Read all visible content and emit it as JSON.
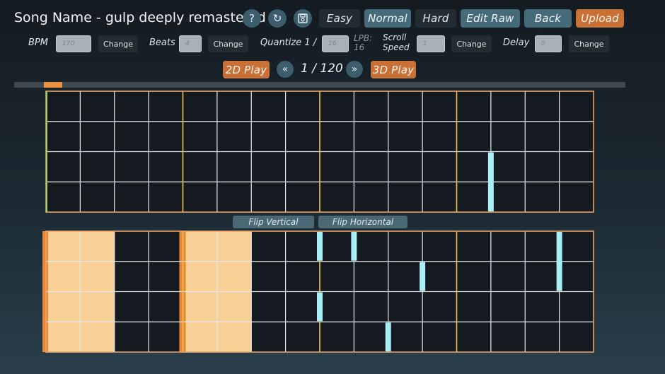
{
  "header": {
    "title": "Song Name - gulp deeply remastered",
    "help_icon": "?",
    "refresh_icon": "↻",
    "save_icon": "save-icon"
  },
  "difficulty": {
    "easy": "Easy",
    "normal": "Normal",
    "hard": "Hard",
    "selected": "Normal"
  },
  "actions": {
    "edit_raw": "Edit Raw",
    "back": "Back",
    "upload": "Upload"
  },
  "settings": {
    "bpm_label": "BPM",
    "bpm_value": "170",
    "beats_label": "Beats",
    "beats_value": "4",
    "quantize_label": "Quantize 1 /",
    "quantize_value": "16",
    "lpb_label": "LPB:",
    "lpb_value": "16",
    "scroll_label_1": "Scroll",
    "scroll_label_2": "Speed",
    "scroll_value": "1",
    "delay_label": "Delay",
    "delay_value": "0",
    "change_label": "Change"
  },
  "playback": {
    "play2d": "2D Play",
    "play3d": "3D Play",
    "prev_icon": "«",
    "next_icon": "»",
    "page_text": "1 / 120",
    "progress_fraction": 0.03
  },
  "flip": {
    "vertical": "Flip Vertical",
    "horizontal": "Flip Horizontal"
  },
  "colors": {
    "grid_line": "#e8e8e8",
    "beat_line": "#f2c14a",
    "measure_start": "#8fd46a",
    "border": "#e9a36a",
    "note": "#a9eef6",
    "highlight": "#f8cf95",
    "highlight_edge": "#e8863a"
  },
  "top_grid": {
    "lanes": 4,
    "columns": 16,
    "notes": [
      {
        "col": 13,
        "lane_from": 2,
        "lane_to": 4
      }
    ]
  },
  "bottom_grid": {
    "lanes": 4,
    "columns": 16,
    "highlight_columns": [
      0,
      1,
      4,
      5
    ],
    "notes": [
      {
        "col": 8,
        "lane_from": 0,
        "lane_to": 1
      },
      {
        "col": 9,
        "lane_from": 0,
        "lane_to": 1
      },
      {
        "col": 11,
        "lane_from": 1,
        "lane_to": 2
      },
      {
        "col": 8,
        "lane_from": 2,
        "lane_to": 3
      },
      {
        "col": 10,
        "lane_from": 3,
        "lane_to": 4
      },
      {
        "col": 15,
        "lane_from": 0,
        "lane_to": 2
      }
    ]
  }
}
